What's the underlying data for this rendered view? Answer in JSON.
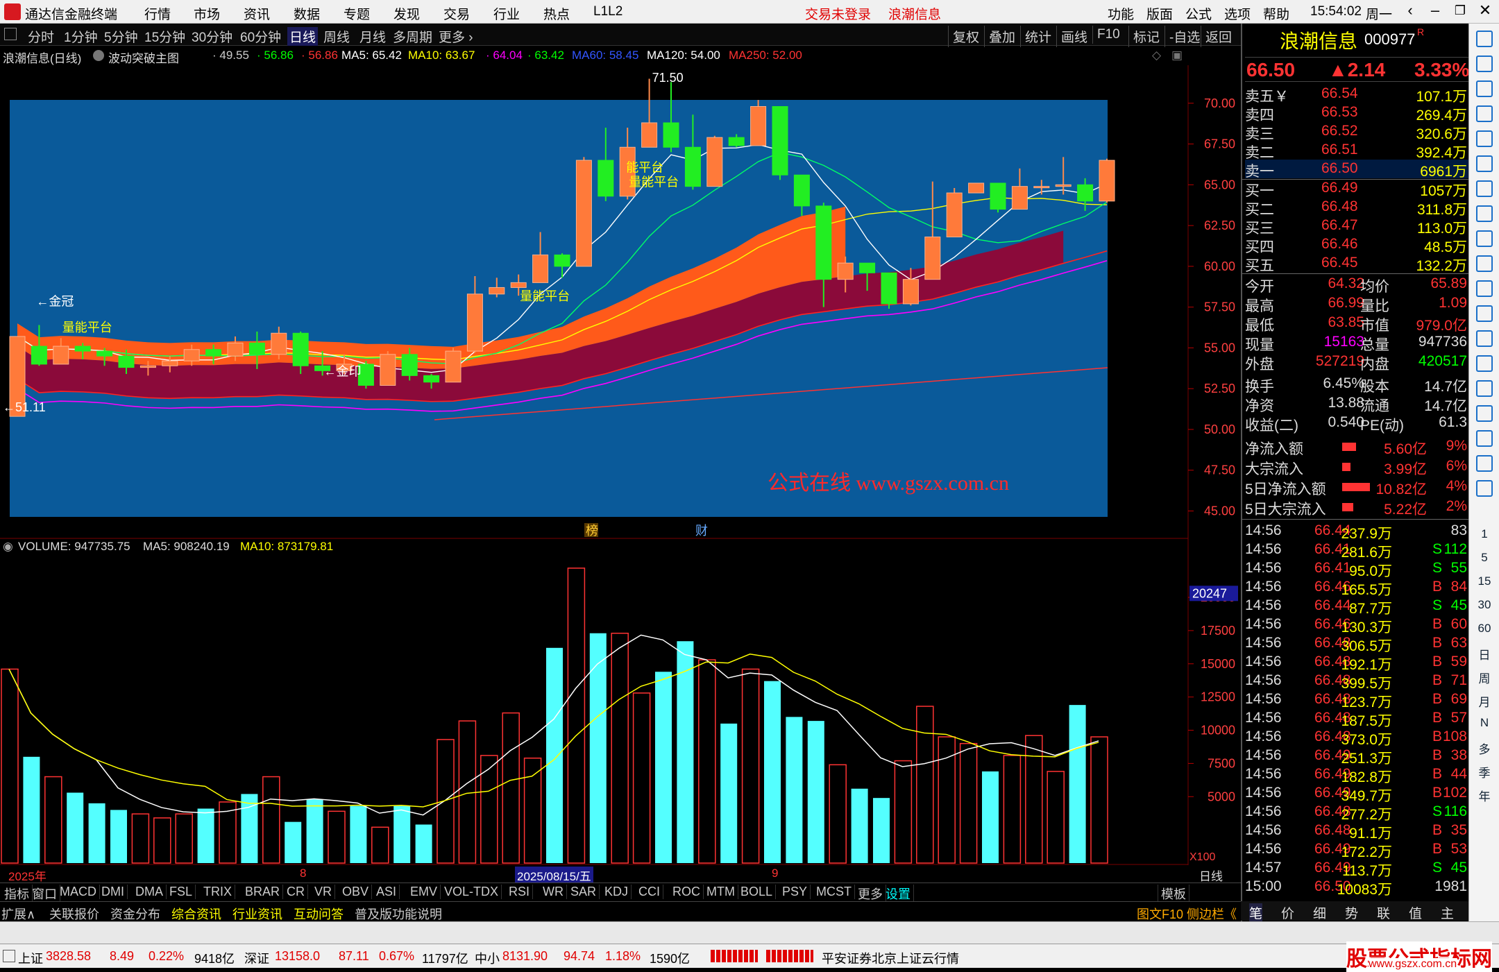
{
  "titlebar": {
    "app_name": "通达信金融终端",
    "menus": [
      "行情",
      "市场",
      "资讯",
      "数据",
      "专题",
      "发现",
      "交易",
      "行业",
      "热点",
      "L1L2"
    ],
    "center": [
      "交易未登录",
      "浪潮信息"
    ],
    "right_menus": [
      "功能",
      "版面",
      "公式",
      "选项",
      "帮助"
    ],
    "time": "15:54:02",
    "weekday": "周一"
  },
  "toolbar": {
    "periods": [
      "分时",
      "1分钟",
      "5分钟",
      "15分钟",
      "30分钟",
      "60分钟",
      "日线",
      "周线",
      "月线",
      "多周期",
      "更多 ›"
    ],
    "active": "日线",
    "right_buttons": [
      "复权",
      "叠加",
      "统计",
      "画线",
      "F10",
      "标记",
      "-自选",
      "返回"
    ]
  },
  "infoline": {
    "stock": "浪潮信息(日线)",
    "indicator": "波动突破主图",
    "values": [
      "· 49.55",
      "· 56.86",
      "· 56.86",
      "MA5: 65.42",
      "MA10: 63.67",
      "· 64.04",
      "· 63.42",
      "MA60: 58.45",
      "MA120: 54.00",
      "MA250: 52.00"
    ],
    "colors": [
      "#cccccc",
      "#00ff00",
      "#ff3333",
      "#ffffff",
      "#ffff00",
      "#ff00ff",
      "#00ff00",
      "#3355ff",
      "#ffffff",
      "#ff3333"
    ]
  },
  "chart": {
    "yticks": [
      "70.00",
      "67.50",
      "65.00",
      "62.50",
      "60.00",
      "57.50",
      "55.00",
      "52.50",
      "50.00",
      "47.50",
      "45.00"
    ],
    "annotations": [
      "71.50",
      "←金冠",
      "量能平台",
      "←51.11",
      "←金印",
      "量能平台",
      "能平台",
      "量能平台"
    ],
    "watermark": "公式在线  www.gszx.com.cn",
    "markers": [
      "榜",
      "财"
    ]
  },
  "volume": {
    "header": [
      "VOLUME: 947735.75",
      "MA5: 908240.19",
      "MA10: 873179.81"
    ],
    "yticks": [
      "20000",
      "17500",
      "15000",
      "12500",
      "10000",
      "7500",
      "5000"
    ],
    "cursor_value": "20247",
    "scale": "X100",
    "dates": [
      "2025年",
      "8",
      "2025/08/15/五",
      "9"
    ],
    "period_label": "日线"
  },
  "indicator_tabs": [
    "指标",
    "窗口",
    "MACD",
    "DMI",
    "DMA",
    "FSL",
    "TRIX",
    "BRAR",
    "CR",
    "VR",
    "OBV",
    "ASI",
    "EMV",
    "VOL-TDX",
    "RSI",
    "WR",
    "SAR",
    "KDJ",
    "CCI",
    "ROC",
    "MTM",
    "BOLL",
    "PSY",
    "MCST",
    "更多",
    "设置"
  ],
  "template_label": "模板",
  "info_tabs": [
    "扩展∧",
    "关联报价",
    "资金分布",
    "综合资讯",
    "行业资讯",
    "互动问答",
    "普及版功能说明"
  ],
  "info_right": "图文F10 侧边栏《",
  "quote": {
    "name": "浪潮信息",
    "code": "000977",
    "tag": "R",
    "price": "66.50",
    "change": "▲2.14",
    "pct": "3.33%",
    "asks": [
      [
        "卖五￥",
        "66.54",
        "107.1万"
      ],
      [
        "卖四",
        "66.53",
        "269.4万"
      ],
      [
        "卖三",
        "66.52",
        "320.6万"
      ],
      [
        "卖二",
        "66.51",
        "392.4万"
      ],
      [
        "卖一",
        "66.50",
        "6961万"
      ]
    ],
    "bids": [
      [
        "买一",
        "66.49",
        "1057万"
      ],
      [
        "买二",
        "66.48",
        "311.8万"
      ],
      [
        "买三",
        "66.47",
        "113.0万"
      ],
      [
        "买四",
        "66.46",
        "48.5万"
      ],
      [
        "买五",
        "66.45",
        "132.2万"
      ]
    ],
    "stats": [
      [
        "今开",
        "64.32",
        "均价",
        "65.89"
      ],
      [
        "最高",
        "66.99",
        "量比",
        "1.09"
      ],
      [
        "最低",
        "63.85",
        "市值",
        "979.0亿"
      ],
      [
        "现量",
        "15163",
        "总量",
        "947736"
      ],
      [
        "外盘",
        "527219",
        "内盘",
        "420517"
      ],
      [
        "换手",
        "6.45%",
        "股本",
        "14.7亿"
      ],
      [
        "净资",
        "13.88",
        "流通",
        "14.7亿"
      ],
      [
        "收益(二)",
        "0.540",
        "PE(动)",
        "61.3"
      ]
    ],
    "flows": [
      [
        "净流入额",
        "5.60亿",
        "9%"
      ],
      [
        "大宗流入",
        "3.99亿",
        "6%"
      ],
      [
        "5日净流入额",
        "10.82亿",
        "4%"
      ],
      [
        "5日大宗流入",
        "5.22亿",
        "2%"
      ]
    ],
    "ticks": [
      [
        "14:56",
        "66.44",
        "237.9万",
        "",
        "83"
      ],
      [
        "14:56",
        "66.41",
        "281.6万",
        "S",
        "112"
      ],
      [
        "14:56",
        "66.41",
        "95.0万",
        "S",
        "55"
      ],
      [
        "14:56",
        "66.46",
        "165.5万",
        "B",
        "84"
      ],
      [
        "14:56",
        "66.44",
        "87.7万",
        "S",
        "45"
      ],
      [
        "14:56",
        "66.46",
        "130.3万",
        "B",
        "60"
      ],
      [
        "14:56",
        "66.48",
        "306.5万",
        "B",
        "63"
      ],
      [
        "14:56",
        "66.48",
        "192.1万",
        "B",
        "59"
      ],
      [
        "14:56",
        "66.48",
        "399.5万",
        "B",
        "71"
      ],
      [
        "14:56",
        "66.48",
        "123.7万",
        "B",
        "69"
      ],
      [
        "14:56",
        "66.48",
        "187.5万",
        "B",
        "57"
      ],
      [
        "14:56",
        "66.48",
        "373.0万",
        "B",
        "108"
      ],
      [
        "14:56",
        "66.49",
        "251.3万",
        "B",
        "38"
      ],
      [
        "14:56",
        "66.49",
        "182.8万",
        "B",
        "44"
      ],
      [
        "14:56",
        "66.49",
        "349.7万",
        "B",
        "102"
      ],
      [
        "14:56",
        "66.48",
        "277.2万",
        "S",
        "116"
      ],
      [
        "14:56",
        "66.48",
        "91.1万",
        "B",
        "35"
      ],
      [
        "14:56",
        "66.49",
        "172.2万",
        "B",
        "53"
      ],
      [
        "14:57",
        "66.49",
        "113.7万",
        "S",
        "45"
      ],
      [
        "15:00",
        "66.50",
        "10083万",
        "",
        "1981"
      ]
    ],
    "tabs": [
      "笔",
      "价",
      "细",
      "势",
      "联",
      "值",
      "主",
      "筹"
    ]
  },
  "sidebar_labels": [
    "1",
    "5",
    "15",
    "30",
    "60",
    "日",
    "周",
    "月",
    "N",
    "多",
    "季",
    "年"
  ],
  "status": {
    "indices": [
      [
        "上证",
        "3828.58",
        "8.49",
        "0.22%",
        "9418亿"
      ],
      [
        "深证",
        "13158.0",
        "87.11",
        "0.67%",
        "11797亿"
      ],
      [
        "中小",
        "8131.90",
        "94.74",
        "1.18%",
        "1590亿"
      ]
    ],
    "broker": "平安证券北京上证云行情",
    "brand": "股票公式指标网",
    "url": "www.gszx.com.cn"
  },
  "colors": {
    "up": "#ff3333",
    "down": "#00ff00",
    "panel_bg": "#0a5a9a",
    "yellow": "#ffff00",
    "cyan": "#54ffff"
  },
  "chart_data": {
    "type": "candlestick",
    "candles": [
      [
        50.8,
        55.7,
        50.8,
        55.1
      ],
      [
        55.1,
        54.0,
        53.9,
        56.4
      ],
      [
        54.0,
        55.1,
        54.0,
        55.6
      ],
      [
        55.1,
        54.8,
        54.3,
        55.3
      ],
      [
        54.8,
        54.5,
        53.9,
        55.0
      ],
      [
        54.5,
        53.8,
        53.4,
        54.9
      ],
      [
        53.8,
        53.9,
        53.3,
        54.2
      ],
      [
        53.9,
        54.2,
        53.5,
        54.5
      ],
      [
        54.2,
        54.9,
        53.9,
        55.2
      ],
      [
        54.9,
        54.5,
        54.0,
        55.2
      ],
      [
        54.5,
        55.3,
        54.2,
        55.7
      ],
      [
        55.3,
        54.6,
        53.7,
        56.0
      ],
      [
        54.6,
        55.9,
        54.3,
        56.3
      ],
      [
        55.9,
        53.9,
        53.4,
        56.0
      ],
      [
        53.9,
        53.6,
        53.3,
        54.8
      ],
      [
        53.6,
        54.0,
        53.4,
        54.6
      ],
      [
        54.0,
        52.7,
        52.5,
        54.2
      ],
      [
        52.7,
        54.6,
        52.7,
        54.8
      ],
      [
        54.6,
        53.3,
        53.0,
        55.0
      ],
      [
        53.3,
        52.9,
        52.5,
        53.4
      ],
      [
        52.9,
        54.8,
        52.9,
        55.0
      ],
      [
        54.8,
        58.3,
        54.7,
        59.4
      ],
      [
        58.3,
        58.7,
        58.1,
        59.3
      ],
      [
        58.7,
        59.0,
        58.2,
        59.5
      ],
      [
        59.0,
        60.7,
        59.0,
        62.1
      ],
      [
        60.7,
        60.0,
        59.3,
        60.8
      ],
      [
        60.0,
        66.5,
        60.0,
        66.7
      ],
      [
        66.5,
        64.3,
        64.0,
        68.5
      ],
      [
        64.3,
        67.3,
        64.1,
        68.5
      ],
      [
        67.3,
        68.8,
        68.5,
        71.5
      ],
      [
        68.8,
        67.3,
        67.0,
        71.3
      ],
      [
        67.3,
        64.9,
        64.7,
        69.3
      ],
      [
        64.9,
        67.9,
        64.9,
        68.0
      ],
      [
        67.9,
        67.4,
        67.3,
        68.1
      ],
      [
        67.4,
        69.8,
        67.4,
        70.2
      ],
      [
        69.8,
        65.6,
        65.3,
        68.2
      ],
      [
        65.6,
        63.7,
        63.1,
        64.0
      ],
      [
        63.7,
        59.2,
        57.5,
        63.9
      ],
      [
        59.2,
        60.2,
        58.4,
        60.6
      ],
      [
        60.2,
        59.6,
        58.5,
        60.1
      ],
      [
        59.6,
        57.7,
        57.4,
        59.0
      ],
      [
        57.7,
        59.2,
        57.6,
        59.9
      ],
      [
        59.2,
        61.8,
        59.2,
        65.2
      ],
      [
        61.8,
        64.5,
        63.9,
        64.8
      ],
      [
        64.5,
        65.1,
        65.1,
        64.4
      ],
      [
        65.1,
        63.5,
        63.3,
        64.8
      ],
      [
        63.5,
        64.9,
        63.5,
        66.0
      ],
      [
        64.9,
        64.9,
        64.4,
        65.3
      ],
      [
        64.9,
        65.0,
        64.4,
        66.7
      ],
      [
        65.0,
        64.0,
        63.4,
        65.4
      ],
      [
        64.0,
        66.5,
        63.9,
        66.6
      ]
    ],
    "volume": [
      14600,
      8000,
      6500,
      5300,
      4500,
      4000,
      3700,
      3400,
      3700,
      4100,
      4600,
      5200,
      6500,
      3100,
      4800,
      3900,
      4300,
      2700,
      4300,
      2900,
      9300,
      10700,
      8100,
      11300,
      7900,
      16200,
      22200,
      17300,
      17300,
      12800,
      14400,
      16700,
      15300,
      10500,
      14600,
      13700,
      11000,
      10700,
      7400,
      5600,
      4900,
      7700,
      11800,
      9500,
      9000,
      6900,
      8100,
      9600,
      6900,
      11900,
      9500
    ],
    "ma5": [
      65.42
    ],
    "ma10": [
      63.67
    ],
    "ma60": [
      58.45
    ],
    "ma120": [
      54.0
    ],
    "ma250": [
      52.0
    ],
    "ylim": [
      44.0,
      72.5
    ]
  }
}
